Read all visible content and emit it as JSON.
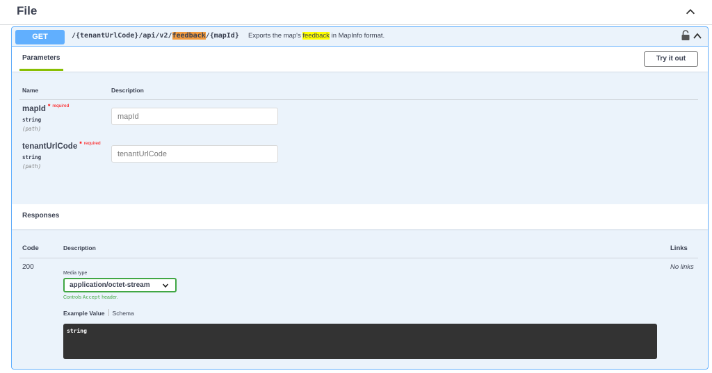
{
  "section": {
    "title": "File"
  },
  "operation": {
    "method": "GET",
    "path_prefix": "/{tenantUrlCode}/api/v2/",
    "path_highlight": "feedback",
    "path_suffix": "/{mapId}",
    "summary_prefix": "Exports the map's ",
    "summary_highlight": "feedback",
    "summary_suffix": " in MapInfo format.",
    "colors": {
      "method": "#61affe",
      "border": "#61affe",
      "background": "#ebf3fb"
    }
  },
  "parameters": {
    "tab_label": "Parameters",
    "try_button": "Try it out",
    "col_name": "Name",
    "col_description": "Description",
    "required_star": "*",
    "required_text": "required",
    "items": [
      {
        "name": "mapId",
        "type": "string",
        "in": "(path)",
        "placeholder": "mapId"
      },
      {
        "name": "tenantUrlCode",
        "type": "string",
        "in": "(path)",
        "placeholder": "tenantUrlCode"
      }
    ]
  },
  "responses": {
    "title": "Responses",
    "col_code": "Code",
    "col_description": "Description",
    "col_links": "Links",
    "items": [
      {
        "code": "200",
        "media_type_label": "Media type",
        "media_type_value": "application/octet-stream",
        "controls_prefix": "Controls ",
        "controls_mono": "Accept",
        "controls_suffix": " header.",
        "example_tab": "Example Value",
        "schema_tab": "Schema",
        "example_body": "string",
        "links": "No links"
      }
    ]
  }
}
